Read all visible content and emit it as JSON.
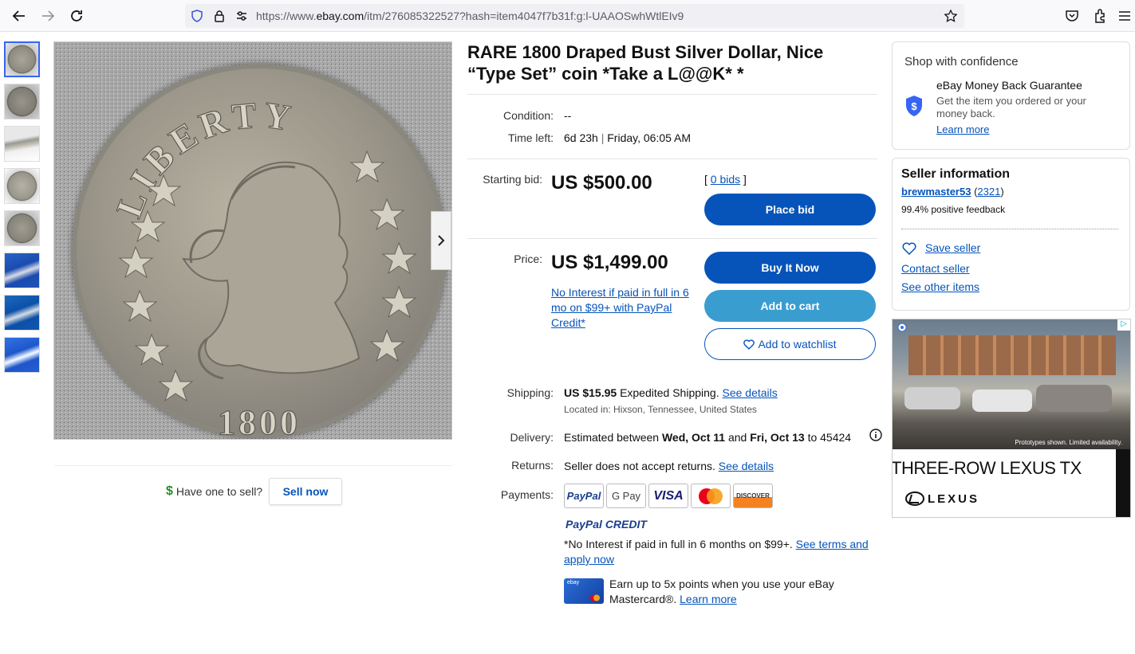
{
  "browser": {
    "url_prefix": "https://www.",
    "url_domain": "ebay.com",
    "url_path": "/itm/276085322527?hash=item4047f7b31f:g:l-UAAOSwhWtlEIv9"
  },
  "gallery": {
    "thumbs": [
      "coin-front",
      "coin-back",
      "coin-edge",
      "coin-front-2",
      "coin-back-2",
      "coin-blue-1",
      "coin-blue-2",
      "coin-blue-3"
    ],
    "coin_legend": "LIBERTY",
    "coin_year": "1800",
    "have_one": "Have one to sell?",
    "sell_now": "Sell now"
  },
  "listing": {
    "title": "RARE 1800 Draped Bust Silver Dollar, Nice “Type Set” coin *Take a L@@K* *",
    "condition_label": "Condition:",
    "condition_value": "--",
    "time_left_label": "Time left:",
    "time_left_value": "6d 23h",
    "time_left_end": "Friday, 06:05 AM",
    "starting_bid_label": "Starting bid:",
    "starting_bid": "US $500.00",
    "bids_open": "[",
    "bids_link": "0 bids",
    "bids_close": "]",
    "place_bid": "Place bid",
    "price_label": "Price:",
    "price": "US $1,499.00",
    "financing_link": "No Interest if paid in full in 6 mo on $99+ with PayPal Credit*",
    "buy_now": "Buy It Now",
    "add_to_cart": "Add to cart",
    "add_to_watchlist": "Add to watchlist",
    "shipping_label": "Shipping:",
    "shipping_cost": "US $15.95",
    "shipping_method": "Expedited Shipping.",
    "see_details": "See details",
    "located_in": "Located in: Hixson, Tennessee, United States",
    "delivery_label": "Delivery:",
    "delivery_prefix": "Estimated between",
    "delivery_from": "Wed, Oct 11",
    "delivery_and": "and",
    "delivery_to": "Fri, Oct 13",
    "delivery_zip": "to 45424",
    "returns_label": "Returns:",
    "returns_text": "Seller does not accept returns.",
    "payments_label": "Payments:",
    "payment_methods": [
      "PayPal",
      "G Pay",
      "VISA",
      "Mastercard",
      "DISCOVER"
    ],
    "paypal_credit": "PayPal CREDIT",
    "credit_note": "*No Interest if paid in full in 6 months on $99+.",
    "credit_terms_link": "See terms and apply now",
    "card_promo": "Earn up to 5x points when you use your eBay Mastercard®.",
    "card_learn_more": "Learn more"
  },
  "confidence": {
    "heading": "Shop with confidence",
    "guarantee_title": "eBay Money Back Guarantee",
    "guarantee_text": "Get the item you ordered or your money back.",
    "learn_more": "Learn more"
  },
  "seller": {
    "heading": "Seller information",
    "name": "brewmaster53",
    "score_open": "(",
    "score": "2321",
    "score_close": ")",
    "feedback": "99.4% positive feedback",
    "save_seller": "Save seller",
    "contact_seller": "Contact seller",
    "see_other_items": "See other items"
  },
  "ad": {
    "disclaimer": "Prototypes shown. Limited availability.",
    "headline": "THREE-ROW LEXUS TX",
    "brand": "LEXUS"
  },
  "colors": {
    "ebay_blue": "#0654ba",
    "cart_blue": "#3a9dd0",
    "link_blue": "#0654ba"
  }
}
